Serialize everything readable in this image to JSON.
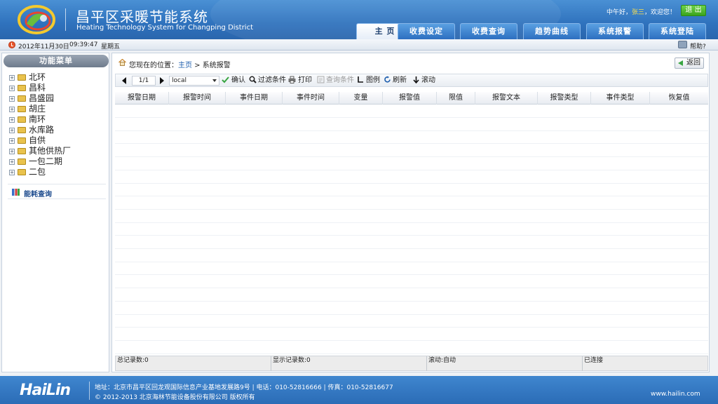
{
  "header": {
    "title_cn": "昌平区采暖节能系统",
    "title_en": "Heating Technology System for Changping District",
    "greeting_prefix": "中午好，",
    "user": "张三",
    "greeting_suffix": "，欢迎您！",
    "logout_label": "退 出"
  },
  "nav": {
    "tabs": [
      {
        "label": "主 页",
        "active": true
      },
      {
        "label": "收费设定",
        "active": false
      },
      {
        "label": "收费查询",
        "active": false
      },
      {
        "label": "趋势曲线",
        "active": false
      },
      {
        "label": "系统报警",
        "active": false
      },
      {
        "label": "系统登陆",
        "active": false
      }
    ]
  },
  "infobar": {
    "date": "2012年11月30日",
    "time": "09:39:47",
    "weekday": "星期五",
    "help_label": "帮助?"
  },
  "sidebar": {
    "header": "功能菜单",
    "tree": [
      "北环",
      "昌科",
      "昌盛园",
      "胡庄",
      "南环",
      "水库路",
      "自供",
      "其他供热厂",
      "一包二期",
      "二包"
    ],
    "energy_query": "能耗查询"
  },
  "breadcrumb": {
    "prefix": "您现在的位置：",
    "home": "主页",
    "separator": " > ",
    "current": "系统报警"
  },
  "back_label": "返回",
  "toolbar": {
    "page": "1/1",
    "db": "local",
    "confirm": "确认",
    "filter": "过滤条件",
    "print": "打印",
    "query_cond": "查询条件",
    "legend": "图例",
    "refresh": "刷新",
    "scroll": "滚动"
  },
  "table": {
    "columns": [
      "报警日期",
      "报警时间",
      "事件日期",
      "事件时间",
      "变量",
      "报警值",
      "限值",
      "报警文本",
      "报警类型",
      "事件类型",
      "恢复值"
    ]
  },
  "status": {
    "total": "总记录数:0",
    "shown": "显示记录数:0",
    "scroll": "滚动:自动",
    "conn": "已连接"
  },
  "footer": {
    "logo": "HaiLin",
    "address": "地址：北京市昌平区回龙观国际信息产业基地发展路9号 | 电话：010-52816666 | 传真：010-52816677",
    "copyright": "© 2012-2013 北京海林节能设备股份有限公司 版权所有",
    "site": "www.hailin.com"
  },
  "colors": {
    "header_blue": "#2f72bd",
    "accent_green": "#3aa31c",
    "username_yellow": "#ffe14a"
  }
}
